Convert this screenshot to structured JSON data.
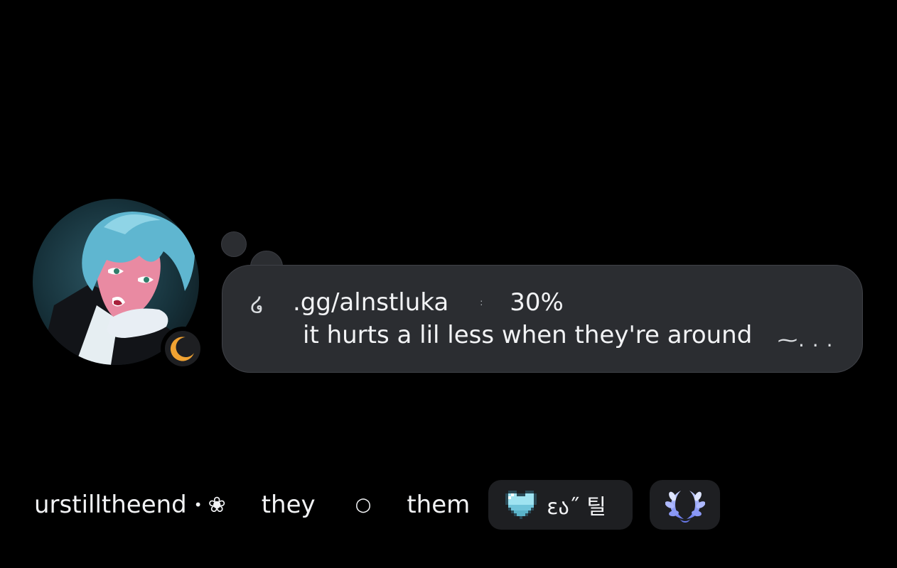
{
  "profile": {
    "avatar_icon": "anime-avatar",
    "status": "idle",
    "status_icon": "moon-icon",
    "status_color": "#f0a232"
  },
  "custom_status": {
    "hook_glyph": "໒",
    "invite_text": ".gg/alnstluka",
    "separator_glyph": ":",
    "percent_text": "30%",
    "message": "it hurts a lil less when they're around",
    "tail_text": "⁓. . ."
  },
  "bio_line": {
    "username": "urstilltheend",
    "dot": "•",
    "flower": "❀",
    "pronoun_1": "they",
    "circle": "○",
    "pronoun_2": "them"
  },
  "tags": {
    "tag_1_icon": "pixel-heart-icon",
    "tag_1_text": "εა˝ 틸",
    "tag_2_icon": "laurel-wreath-icon"
  },
  "colors": {
    "background": "#000000",
    "bubble": "#2b2d31",
    "chip": "#1e1f22",
    "text": "#f2f3f5",
    "idle": "#f0a232"
  }
}
